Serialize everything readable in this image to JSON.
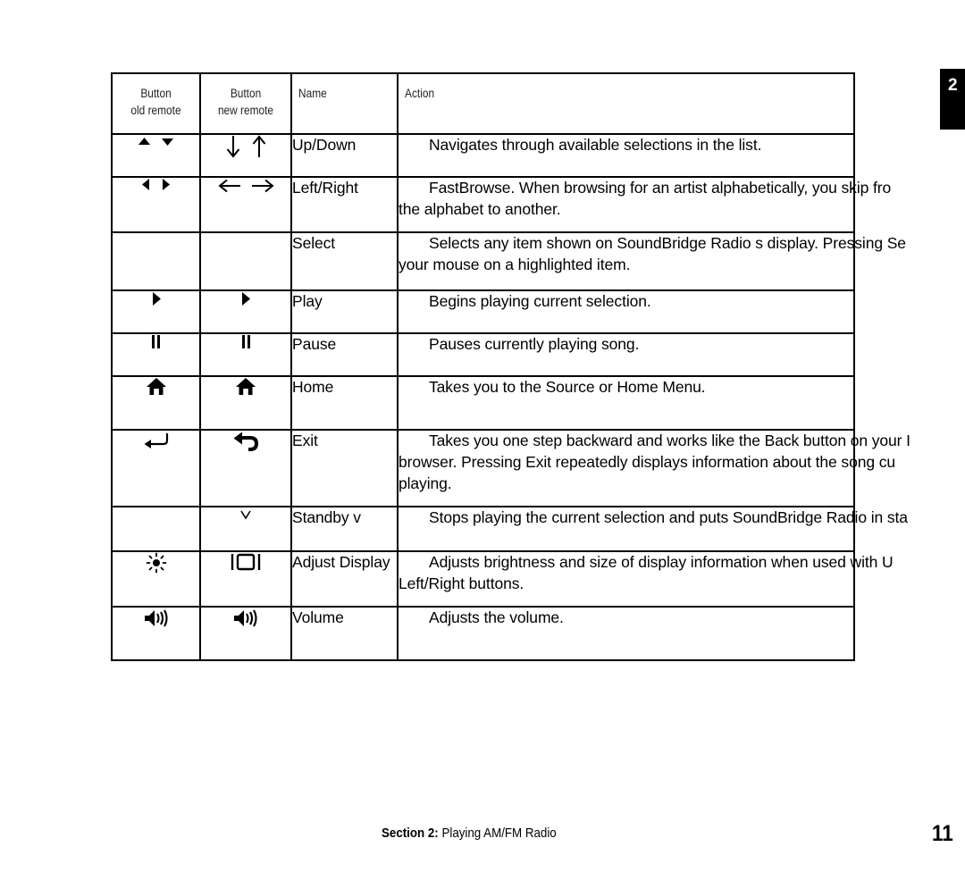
{
  "section_tab": {
    "number": "2"
  },
  "table": {
    "headers": [
      {
        "line1": "Button",
        "line2": "old remote"
      },
      {
        "line1": "Button",
        "line2": "new remote"
      },
      {
        "line1": "Name",
        "line2": ""
      },
      {
        "line1": "Action",
        "line2": ""
      }
    ],
    "rows": [
      {
        "old_icon": "up-triangle-down-triangle-icon",
        "new_icon": "down-arrow-up-arrow-icon",
        "name": "Up/Down",
        "action_lines": [
          "Navigates through available selections in the list."
        ]
      },
      {
        "old_icon": "left-triangle-right-triangle-icon",
        "new_icon": "left-arrow-right-arrow-icon",
        "name": "Left/Right",
        "action_lines": [
          "FastBrowse.  When browsing for an artist alphabetically, you skip fro",
          "the alphabet to another."
        ]
      },
      {
        "old_icon": "",
        "new_icon": "",
        "name": "Select",
        "action_lines": [
          "Selects any item shown on SoundBridge Radio s display. Pressing Se",
          "your mouse on a highlighted item."
        ]
      },
      {
        "old_icon": "play-icon",
        "new_icon": "play-icon",
        "name": "Play",
        "action_lines": [
          "Begins playing current selection."
        ]
      },
      {
        "old_icon": "pause-icon",
        "new_icon": "pause-icon",
        "name": "Pause",
        "action_lines": [
          "Pauses currently playing song."
        ]
      },
      {
        "old_icon": "home-icon",
        "new_icon": "home-icon",
        "name": "Home",
        "action_lines": [
          "Takes you to the Source or Home Menu."
        ]
      },
      {
        "old_icon": "return-arrow-icon",
        "new_icon": "back-arrow-icon",
        "name": "Exit",
        "action_lines": [
          "Takes you one step backward and works like the Back button on your I",
          "browser. Pressing Exit repeatedly displays information about the song cu",
          "playing."
        ]
      },
      {
        "old_icon": "",
        "new_icon": "standby-v-icon",
        "name": "Standby    v",
        "action_lines": [
          "Stops playing the current selection and puts SoundBridge Radio in sta"
        ]
      },
      {
        "old_icon": "brightness-sun-icon",
        "new_icon": "display-screen-icon",
        "name": "Adjust Display",
        "action_lines": [
          "Adjusts brightness and size of display information when used with U",
          "Left/Right buttons."
        ]
      },
      {
        "old_icon": "volume-speaker-icon",
        "new_icon": "volume-speaker-icon",
        "name": "Volume",
        "action_lines": [
          "Adjusts the volume."
        ]
      }
    ]
  },
  "footer": {
    "section_label": "Section 2:",
    "section_title": " Playing AM/FM Radio",
    "page_number": "11"
  }
}
